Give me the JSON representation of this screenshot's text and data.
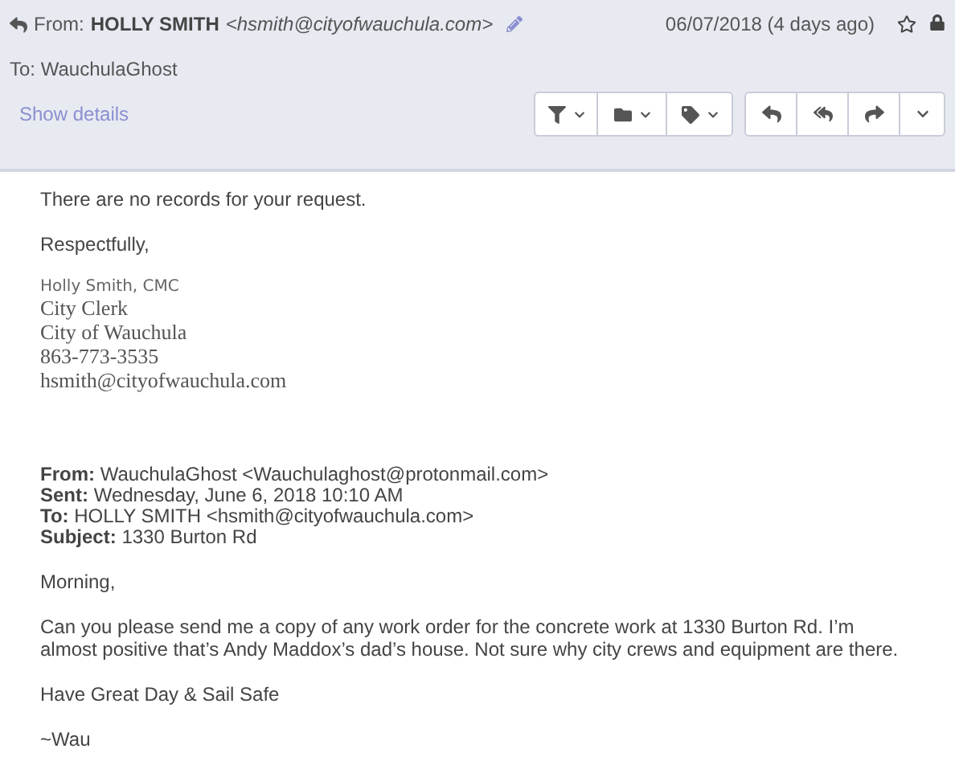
{
  "header": {
    "from": {
      "label": "From:",
      "name": "HOLLY SMITH",
      "address": "<hsmith@cityofwauchula.com>"
    },
    "date": "06/07/2018 (4 days ago)",
    "starred": false,
    "to": "To: WauchulaGhost",
    "details_link": "Show details"
  },
  "body": {
    "paragraphs": [
      "There are no records for your request.",
      "Respectfully,"
    ],
    "signature": {
      "name": "Holly Smith, CMC",
      "lines": [
        "City Clerk",
        "City of Wauchula",
        "863-773-3535",
        "hsmith@cityofwauchula.com"
      ]
    },
    "quoted_header": [
      {
        "label": "From:",
        "value": "WauchulaGhost <Wauchulaghost@protonmail.com>"
      },
      {
        "label": "Sent:",
        "value": "Wednesday, June 6, 2018 10:10 AM"
      },
      {
        "label": "To:",
        "value": "HOLLY SMITH <hsmith@cityofwauchula.com>"
      },
      {
        "label": "Subject:",
        "value": "1330 Burton Rd"
      }
    ],
    "quoted_paragraphs": [
      "Morning,",
      "Can you please send me a copy of any work order for the concrete work at 1330 Burton Rd. I’m almost positive that’s Andy Maddox’s dad’s house. Not sure why city crews and equipment are there.",
      "Have Great Day & Sail Safe",
      "~Wau"
    ]
  }
}
